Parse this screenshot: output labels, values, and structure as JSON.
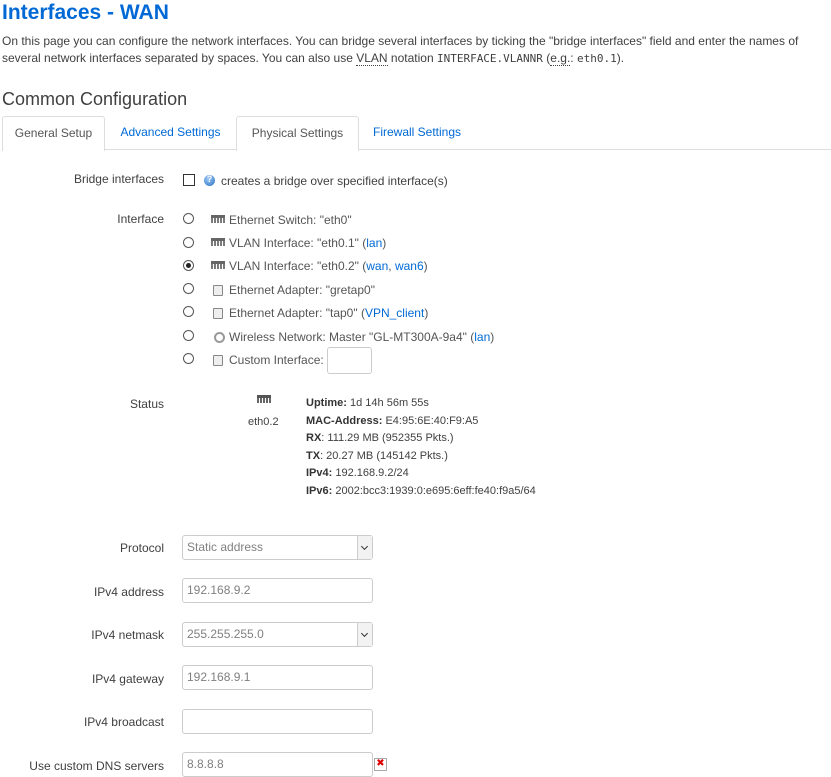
{
  "page": {
    "title": "Interfaces - WAN",
    "desc_a": "On this page you can configure the network interfaces. You can bridge several interfaces by ticking the \"bridge interfaces\" field and enter the names of several network interfaces separated by spaces. You can also use ",
    "desc_vlan": "VLAN",
    "desc_b": " notation ",
    "desc_code": "INTERFACE.VLANNR",
    "desc_c": " (",
    "desc_eg": "e.g.",
    "desc_d": ": ",
    "desc_code2": "eth0.1",
    "desc_e": ")."
  },
  "section_title": "Common Configuration",
  "tabs": [
    {
      "label": "General Setup"
    },
    {
      "label": "Advanced Settings"
    },
    {
      "label": "Physical Settings"
    },
    {
      "label": "Firewall Settings"
    }
  ],
  "bridge": {
    "label": "Bridge interfaces",
    "checked": false,
    "hint": "creates a bridge over specified interface(s)"
  },
  "interface": {
    "label": "Interface",
    "options": [
      {
        "icon": "ethernet-switch-icon",
        "text": "Ethernet Switch: \"eth0\"",
        "paren_open": "",
        "links": [],
        "paren_close": "",
        "checked": false
      },
      {
        "icon": "ethernet-port-icon",
        "text": "VLAN Interface: \"eth0.1\" ",
        "paren_open": "(",
        "links": [
          "lan"
        ],
        "paren_close": ")",
        "checked": false
      },
      {
        "icon": "ethernet-port-icon",
        "text": "VLAN Interface: \"eth0.2\" ",
        "paren_open": "(",
        "links": [
          "wan",
          "wan6"
        ],
        "paren_close": ")",
        "checked": true
      },
      {
        "icon": "ethernet-adapter-icon",
        "text": "Ethernet Adapter: \"gretap0\"",
        "paren_open": "",
        "links": [],
        "paren_close": "",
        "checked": false
      },
      {
        "icon": "ethernet-adapter-icon",
        "text": "Ethernet Adapter: \"tap0\" ",
        "paren_open": "(",
        "links": [
          "VPN_client"
        ],
        "paren_close": ")",
        "checked": false
      },
      {
        "icon": "wireless-icon",
        "text": "Wireless Network: Master \"GL-MT300A-9a4\" ",
        "paren_open": "(",
        "links": [
          "lan"
        ],
        "paren_close": ")",
        "checked": false
      },
      {
        "icon": "custom-interface-icon",
        "text": "Custom Interface:",
        "paren_open": "",
        "links": [],
        "paren_close": "",
        "checked": false
      }
    ]
  },
  "status": {
    "label": "Status",
    "device": "eth0.2",
    "uptime_label": "Uptime:",
    "uptime": " 1d 14h 56m 55s",
    "mac_label": "MAC-Address:",
    "mac": " E4:95:6E:40:F9:A5",
    "rx_label": "RX",
    "rx": ": 111.29 MB (952355 Pkts.)",
    "tx_label": "TX",
    "tx": ": 20.27 MB (145142 Pkts.)",
    "ipv4_label": "IPv4:",
    "ipv4": " 192.168.9.2/24",
    "ipv6_label": "IPv6:",
    "ipv6": " 2002:bcc3:1939:0:e695:6eff:fe40:f9a5/64"
  },
  "protocol": {
    "label": "Protocol",
    "value": "Static address"
  },
  "ipv4_address": {
    "label": "IPv4 address",
    "value": "192.168.9.2"
  },
  "ipv4_netmask": {
    "label": "IPv4 netmask",
    "value": "255.255.255.0"
  },
  "ipv4_gateway": {
    "label": "IPv4 gateway",
    "value": "192.168.9.1"
  },
  "ipv4_broadcast": {
    "label": "IPv4 broadcast",
    "value": ""
  },
  "dns": {
    "label": "Use custom DNS servers",
    "value": "8.8.8.8",
    "remove_glyph": "✖"
  }
}
